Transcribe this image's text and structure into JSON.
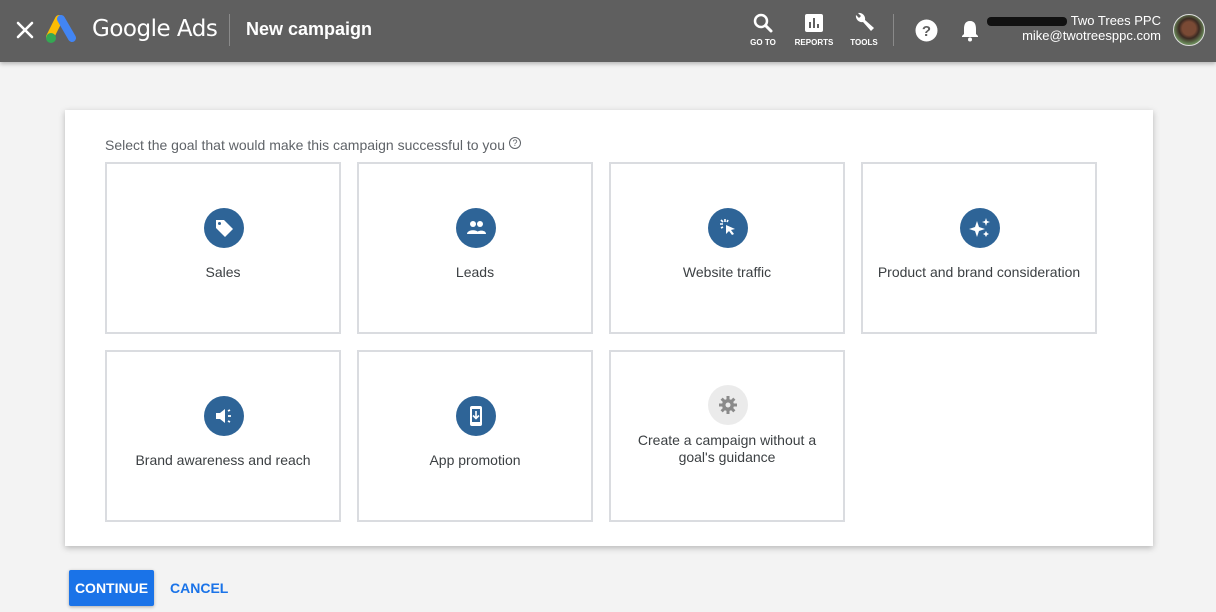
{
  "header": {
    "brand": "Google Ads",
    "page_title": "New campaign",
    "tools": [
      {
        "label": "GO TO",
        "icon": "search-icon"
      },
      {
        "label": "REPORTS",
        "icon": "reports-icon"
      },
      {
        "label": "TOOLS",
        "icon": "wrench-icon"
      }
    ],
    "help_icon": "help-icon",
    "notifications_icon": "bell-icon",
    "account": {
      "name": "Two Trees PPC",
      "email": "mike@twotreesppc.com"
    }
  },
  "main": {
    "prompt": "Select the goal that would make this campaign successful to you",
    "help_glyph": "?",
    "goals": [
      {
        "label": "Sales",
        "icon": "tag-icon"
      },
      {
        "label": "Leads",
        "icon": "people-icon"
      },
      {
        "label": "Website traffic",
        "icon": "cursor-click-icon"
      },
      {
        "label": "Product and brand consideration",
        "icon": "sparkle-icon"
      },
      {
        "label": "Brand awareness and reach",
        "icon": "megaphone-icon"
      },
      {
        "label": "App promotion",
        "icon": "phone-download-icon"
      },
      {
        "label": "Create a campaign without a goal's guidance",
        "icon": "gear-icon"
      }
    ]
  },
  "footer": {
    "continue_label": "CONTINUE",
    "cancel_label": "CANCEL"
  },
  "colors": {
    "header_bg": "#5f5f5f",
    "goal_icon_bg": "#2e6497",
    "primary": "#1a73e8"
  }
}
